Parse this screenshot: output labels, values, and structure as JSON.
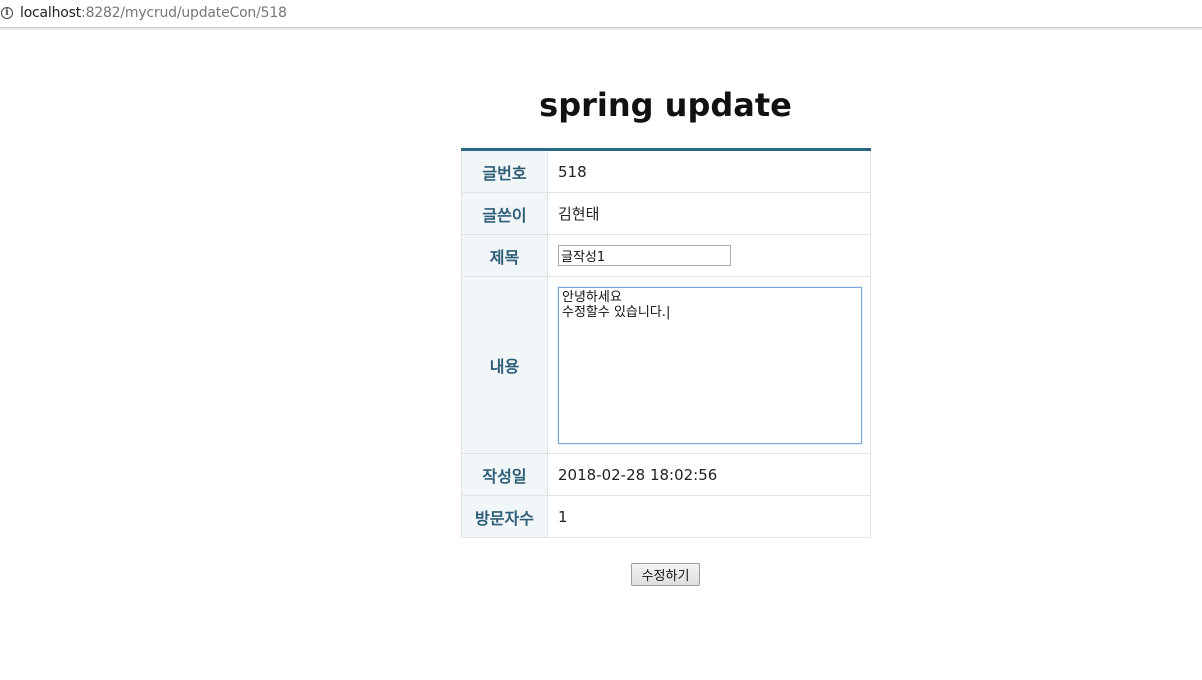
{
  "browser": {
    "url_host": "localhost",
    "url_rest": ":8282/mycrud/updateCon/518"
  },
  "page": {
    "title": "spring update"
  },
  "form": {
    "rows": {
      "no": {
        "label": "글번호",
        "value": "518"
      },
      "writer": {
        "label": "글쓴이",
        "value": "김현태"
      },
      "subject": {
        "label": "제목",
        "value": "글작성1"
      },
      "content": {
        "label": "내용",
        "value": "안녕하세요\n수정할수 있습니다.|"
      },
      "date": {
        "label": "작성일",
        "value": "2018-02-28 18:02:56"
      },
      "visits": {
        "label": "방문자수",
        "value": "1"
      }
    },
    "submit_label": "수정하기"
  },
  "colors": {
    "header_accent": "#2a6782",
    "label_text": "#2e5e78",
    "label_bg": "#f1f6f9"
  }
}
